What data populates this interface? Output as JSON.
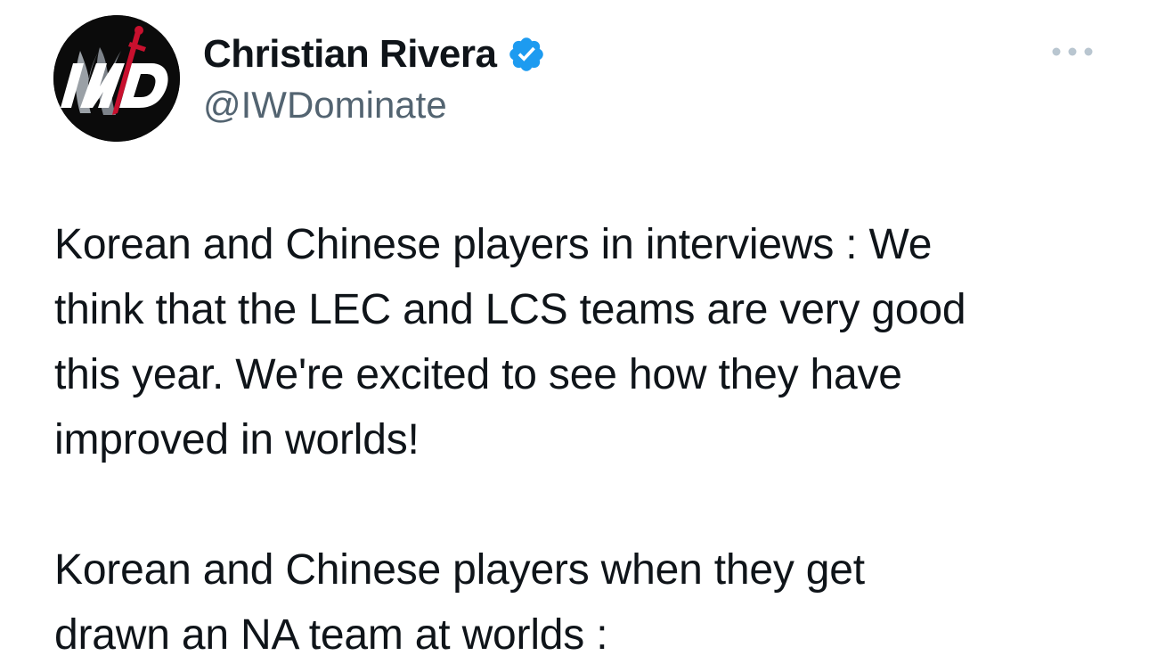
{
  "author": {
    "display_name": "Christian Rivera",
    "handle": "@IWDominate",
    "verified": true,
    "avatar_logo_text": "IWD"
  },
  "tweet": {
    "paragraphs": [
      {
        "lines": [
          "Korean and Chinese players in interviews : We",
          "think that the LEC and LCS teams are very good",
          "this year.  We're excited to see how they have",
          "improved in worlds!"
        ]
      },
      {
        "lines": [
          "Korean and Chinese players when they get",
          "drawn an NA team at worlds :"
        ]
      }
    ]
  },
  "icons": {
    "verified_badge": "verified-badge-icon",
    "more_options": "more-options-icon"
  },
  "colors": {
    "verified_blue": "#1d9bf0",
    "text_primary": "#0f1419",
    "text_secondary": "#536471",
    "more_dots": "#b9c6d0",
    "avatar_bg": "#0b0b0b",
    "avatar_accent": "#c8102e"
  }
}
